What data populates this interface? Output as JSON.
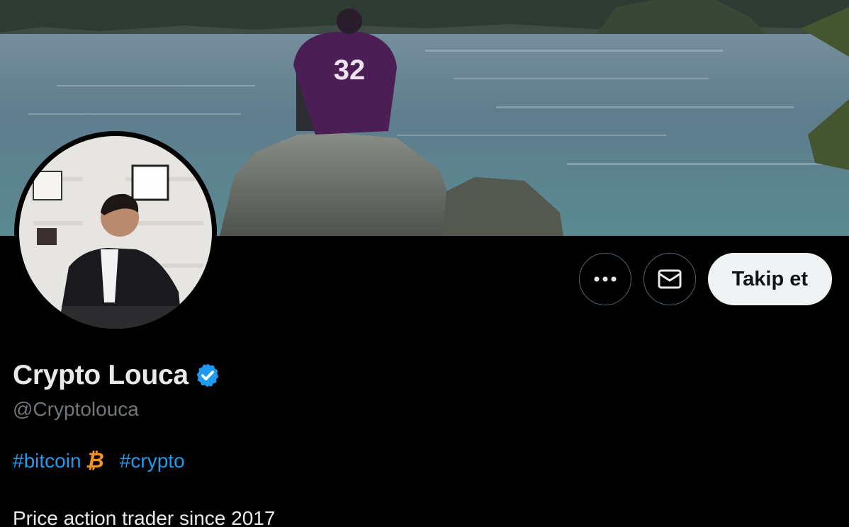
{
  "profile": {
    "display_name": "Crypto Louca",
    "verified": true,
    "handle": "@Cryptolouca",
    "hashtags": [
      "#bitcoin",
      "#crypto"
    ],
    "bitcoin_emoji": "₿",
    "bio": "Price action trader since 2017"
  },
  "banner": {
    "jersey_number": "32"
  },
  "actions": {
    "more_icon": "more-dots-icon",
    "message_icon": "envelope-icon",
    "follow_label": "Takip et"
  },
  "colors": {
    "accent": "#1d9bf0",
    "background": "#000000",
    "follow_bg": "#eff3f4",
    "secondary_text": "#71767b",
    "bitcoin": "#f7931a"
  }
}
